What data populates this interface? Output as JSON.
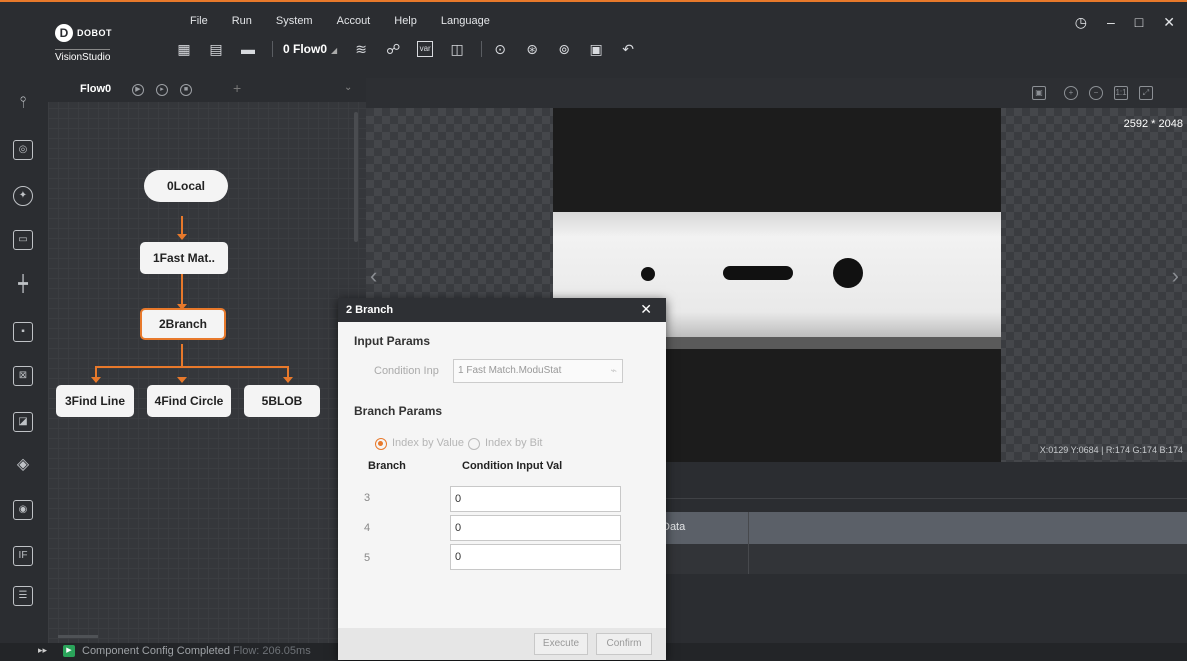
{
  "app": {
    "brand": "DOBOT",
    "product": "VisionStudio",
    "logo_glyph": "D",
    "accent_color": "#e8792b"
  },
  "menu": [
    "File",
    "Run",
    "System",
    "Accout",
    "Help",
    "Language"
  ],
  "window_controls": {
    "clock": "◷",
    "minimize": "–",
    "maximize": "□",
    "close": "✕"
  },
  "toolbar": {
    "icons": [
      "new-solution-icon",
      "save-icon",
      "open-folder-icon"
    ],
    "flow_selector": "0 Flow0",
    "flow_selector_arrow": "◢",
    "more_icons": [
      "layers-icon",
      "network-icon",
      "variable-icon",
      "camera-io-icon",
      "run-once-icon",
      "run-loop-icon",
      "stop-icon",
      "function-icon",
      "undo-icon"
    ],
    "var_label": "var"
  },
  "leftbar_icons": [
    "tool-icon",
    "camera-icon",
    "locate-icon",
    "measure-icon",
    "calibrate-icon",
    "recognize-icon",
    "vision-icon",
    "image-process-icon",
    "color-icon",
    "defect-icon",
    "logic-icon",
    "communication-icon"
  ],
  "flow_panel": {
    "tab_label": "Flow0",
    "tab_buttons": [
      "▶",
      "▸",
      "■"
    ],
    "add_label": "+",
    "chevron": "⌄",
    "nodes": {
      "local": "0Local",
      "fast_match": "1Fast Mat..",
      "branch": "2Branch",
      "find_line": "3Find Line",
      "find_circle": "4Find Circle",
      "blob": "5BLOB"
    }
  },
  "status": {
    "play_glyph": "▶",
    "expand_glyph": "▸▸",
    "message": "Component Config Completed",
    "detail": "Flow: 206.05ms"
  },
  "image_view": {
    "size_label": "2592 * 2048",
    "pixel_info": "X:0129 Y:0684 | R:174 G:174 B:174",
    "left_arrow": "‹",
    "right_arrow": "›"
  },
  "results": {
    "column_label": "Data"
  },
  "dialog": {
    "title": "2 Branch",
    "close_glyph": "✕",
    "input_section": "Input Params",
    "condition_label": "Condition Inp",
    "condition_value": "1 Fast Match.ModuStat",
    "link_glyph": "⌁",
    "branch_section": "Branch Params",
    "radio_value": "Index by Value",
    "radio_bit": "Index by Bit",
    "col_branch": "Branch",
    "col_value": "Condition Input Val",
    "rows": [
      {
        "branch": "3",
        "value": "0"
      },
      {
        "branch": "4",
        "value": "0"
      },
      {
        "branch": "5",
        "value": "0"
      }
    ],
    "execute_label": "Execute",
    "confirm_label": "Confirm"
  }
}
